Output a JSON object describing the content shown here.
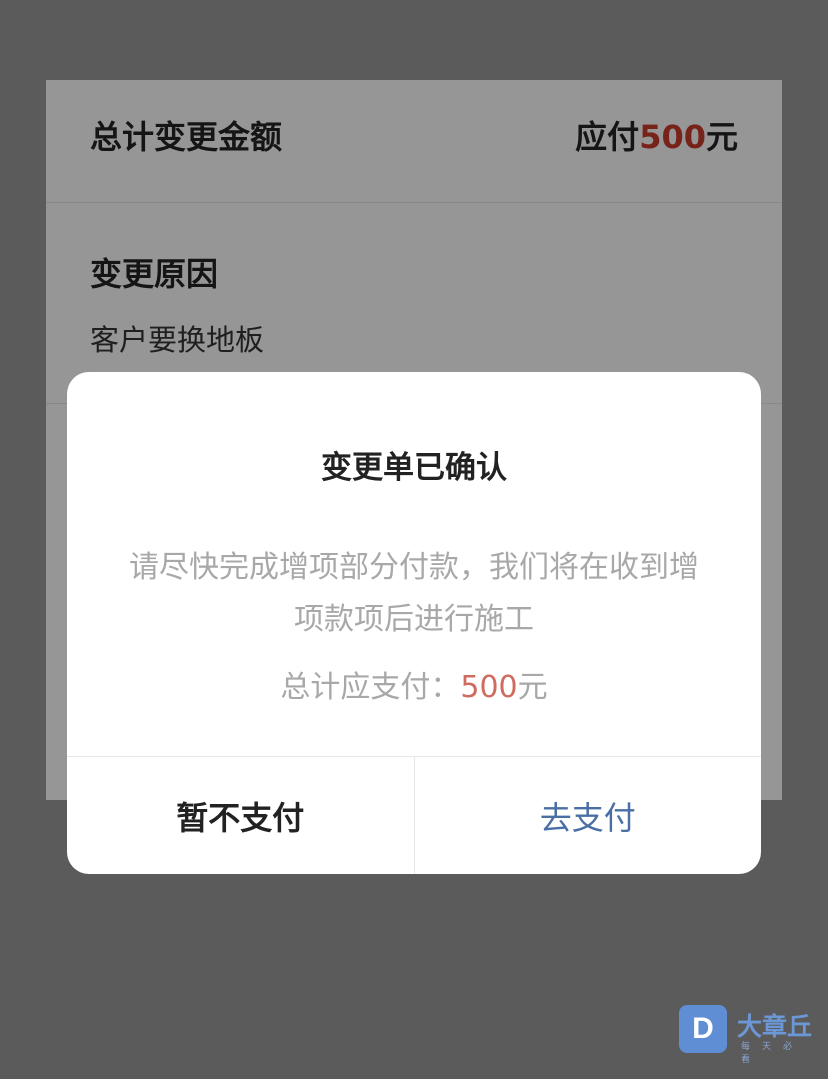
{
  "summary": {
    "total_label": "总计变更金额",
    "total_prefix": "应付",
    "total_amount": "500",
    "total_unit": "元",
    "reason_label": "变更原因",
    "reason_value": "客户要换地板"
  },
  "dialog": {
    "title": "变更单已确认",
    "message": "请尽快完成增项部分付款，我们将在收到增项款项后进行施工",
    "total_prefix": "总计应支付：",
    "total_amount": "500",
    "total_unit": "元",
    "cancel_label": "暂不支付",
    "confirm_label": "去支付"
  },
  "watermark": {
    "logo_letter": "D",
    "name": "大章丘",
    "tagline": "每天必看"
  },
  "colors": {
    "accent_red": "#c0392b",
    "pay_blue": "#4a6fa5",
    "overlay": "rgba(0,0,0,0.38)"
  }
}
